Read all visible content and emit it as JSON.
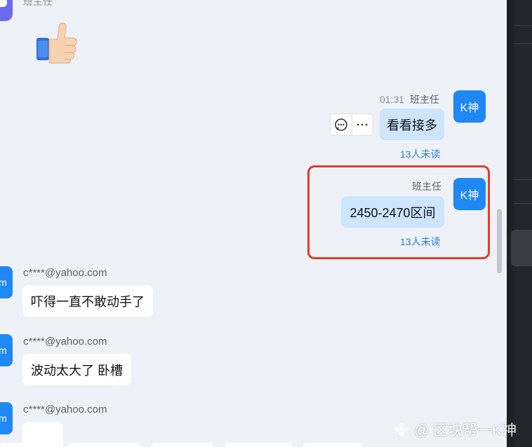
{
  "top_message": {
    "sender_name": "班主任"
  },
  "messages": [
    {
      "time": "01:31",
      "sender": "班主任",
      "avatar": "K神",
      "text": "看看接多",
      "unread": "13人未读"
    },
    {
      "sender": "班主任",
      "avatar": "K神",
      "text": "2450-2470区间",
      "unread": "13人未读"
    }
  ],
  "incoming": [
    {
      "avatar": "m",
      "sender": "c****@yahoo.com",
      "text": "吓得一直不敢动手了"
    },
    {
      "avatar": "m",
      "sender": "c****@yahoo.com",
      "text": "波动太大了 卧槽"
    },
    {
      "avatar": "m",
      "sender": "c****@yahoo.com",
      "text": ""
    }
  ],
  "watermark": "@ 区块帮一K神",
  "colors": {
    "accent": "#1f88f5",
    "bubble_self": "#cde5ff",
    "highlight": "#e23d28",
    "unread": "#2a7fe0"
  },
  "icons": [
    "thumbs-up-emoji",
    "reply-comment-icon",
    "more-dots-icon",
    "binance-logo-icon"
  ]
}
